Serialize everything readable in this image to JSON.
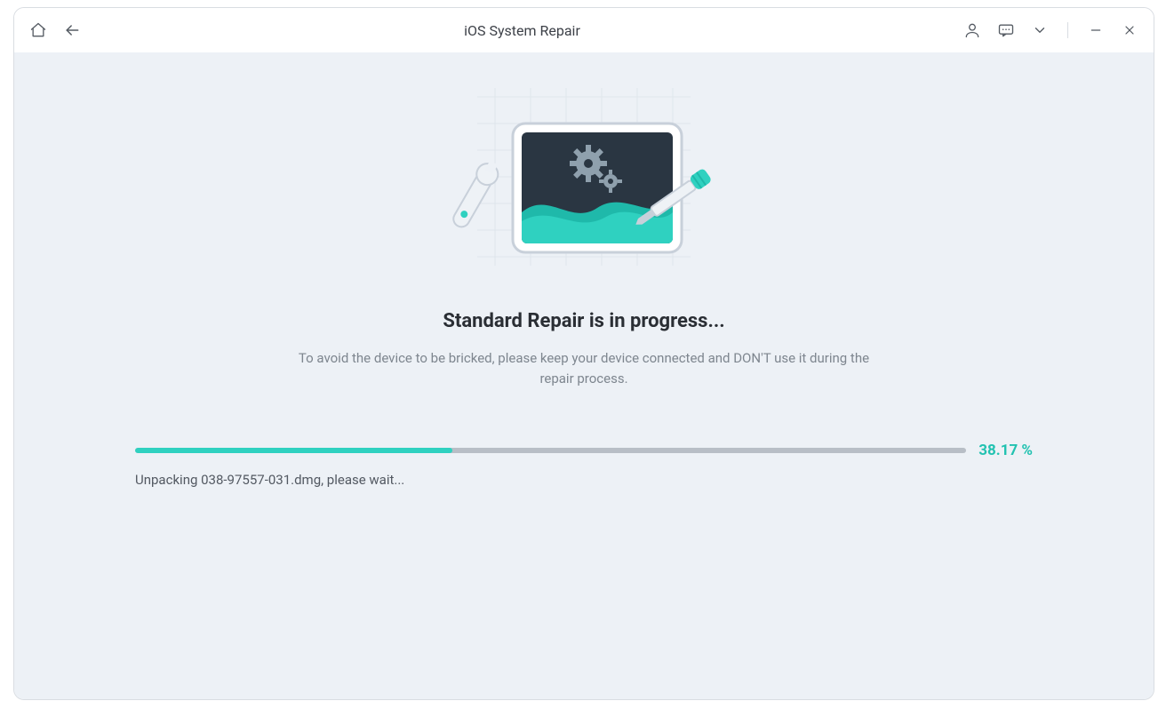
{
  "titlebar": {
    "title": "iOS System Repair"
  },
  "main": {
    "heading": "Standard Repair is in progress...",
    "subheading": "To avoid the device to be bricked, please keep your device connected and DON'T use it during the repair process."
  },
  "progress": {
    "percent": 38.17,
    "percent_label": "38.17 %",
    "status": "Unpacking 038-97557-031.dmg, please wait..."
  }
}
